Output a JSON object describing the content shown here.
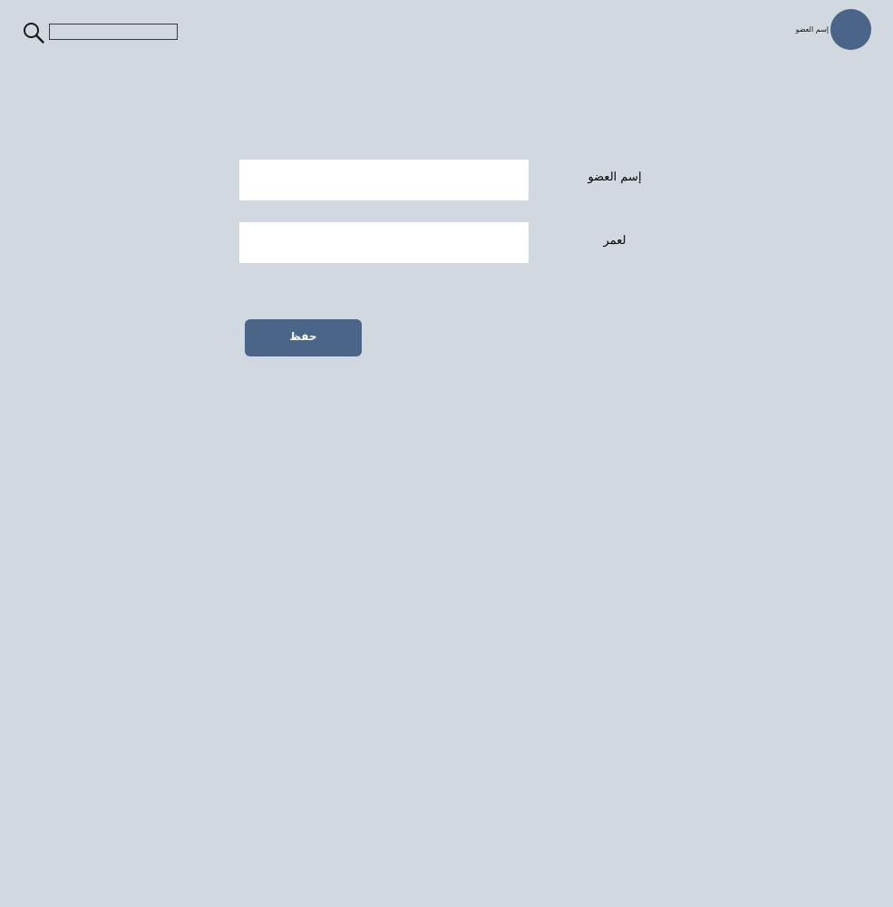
{
  "header": {
    "search": {
      "icon": "search-icon",
      "value": "",
      "placeholder": ""
    },
    "user": {
      "name": "إسم العضو",
      "avatar_color": "#4a6588"
    }
  },
  "form": {
    "fields": [
      {
        "label": "إسم العضو",
        "value": "",
        "placeholder": ""
      },
      {
        "label": "لعمر",
        "value": "",
        "placeholder": ""
      }
    ],
    "save_label": "حفظ"
  },
  "colors": {
    "background": "#d2d8e0",
    "accent": "#4a6588",
    "input_background": "#ffffff",
    "button_text": "#ffffff"
  }
}
